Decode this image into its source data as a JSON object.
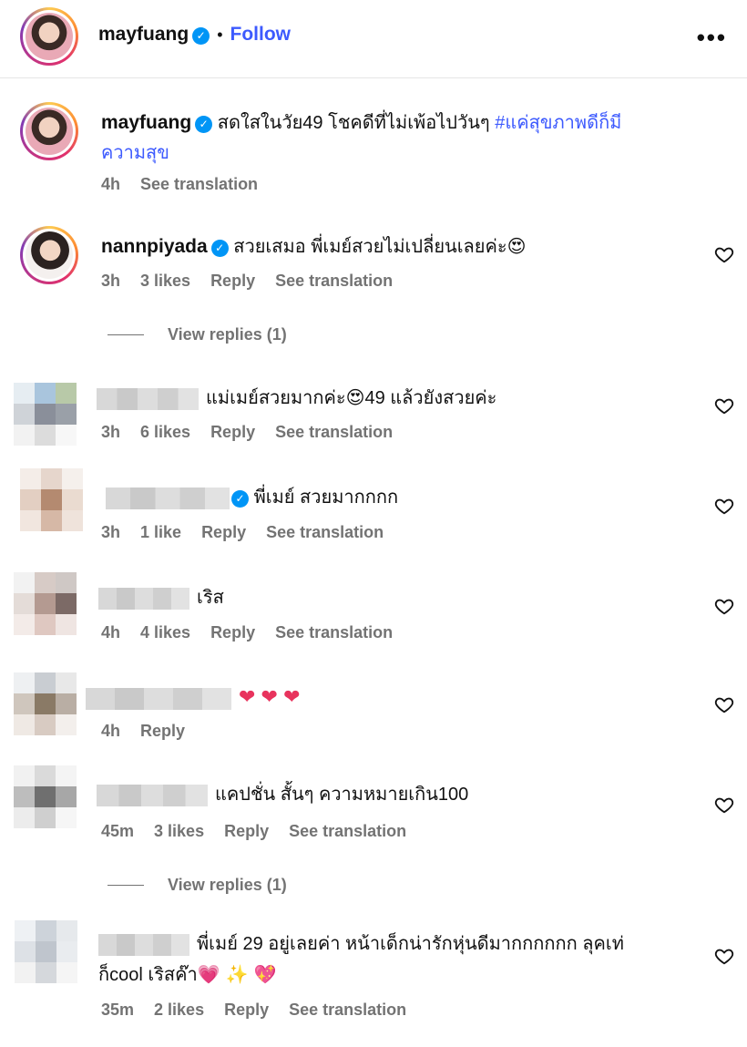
{
  "header": {
    "username": "mayfuang",
    "separator": "•",
    "follow_label": "Follow",
    "more_icon": "more-horizontal-icon",
    "more_label": "•••"
  },
  "caption": {
    "username": "mayfuang",
    "text": "สดใสในวัย49 โชคดีที่ไม่เพ้อไปวันๆ",
    "hashtag_line1": "#แค่สุขภาพดีก็มี",
    "hashtag_line2": "ความสุข",
    "time": "4h",
    "see_translation": "See translation"
  },
  "comments": [
    {
      "username": "nannpiyada",
      "text": "สวยเสมอ พี่เมย์สวยไม่เปลี่ยนเลยค่ะ",
      "emoji": "😍",
      "time": "3h",
      "likes": "3 likes",
      "reply": "Reply",
      "see_translation": "See translation",
      "view_replies": "View replies (1)"
    },
    {
      "text_a": "แม่เมย์สวยมากค่ะ",
      "emoji": "😍",
      "text_b": "49 แล้วยังสวยค่ะ",
      "time": "3h",
      "likes": "6 likes",
      "reply": "Reply",
      "see_translation": "See translation"
    },
    {
      "text": "พี่เมย์ สวยมากกกก",
      "time": "3h",
      "likes": "1 like",
      "reply": "Reply",
      "see_translation": "See translation"
    },
    {
      "text": "เริส",
      "time": "4h",
      "likes": "4 likes",
      "reply": "Reply",
      "see_translation": "See translation"
    },
    {
      "hearts": "❤ ❤ ❤",
      "time": "4h",
      "reply": "Reply"
    },
    {
      "text": "แคปชั่น สั้นๆ ความหมายเกิน100",
      "time": "45m",
      "likes": "3 likes",
      "reply": "Reply",
      "see_translation": "See translation",
      "view_replies": "View replies (1)"
    },
    {
      "text_line1": "พี่เมย์ 29 อยู่เลยค่า หน้าเด็กน่ารักหุ่นดีมากกกกกก ลุคเท่",
      "text_line2": "ก็cool เริสค๊า",
      "emoji_a": "💗",
      "emoji_b": "✨",
      "emoji_c": "💖",
      "time": "35m",
      "likes": "2 likes",
      "reply": "Reply",
      "see_translation": "See translation"
    }
  ],
  "colors": {
    "link_blue": "#3d5afe",
    "verified_blue": "#0095f6",
    "meta_gray": "#737373"
  }
}
